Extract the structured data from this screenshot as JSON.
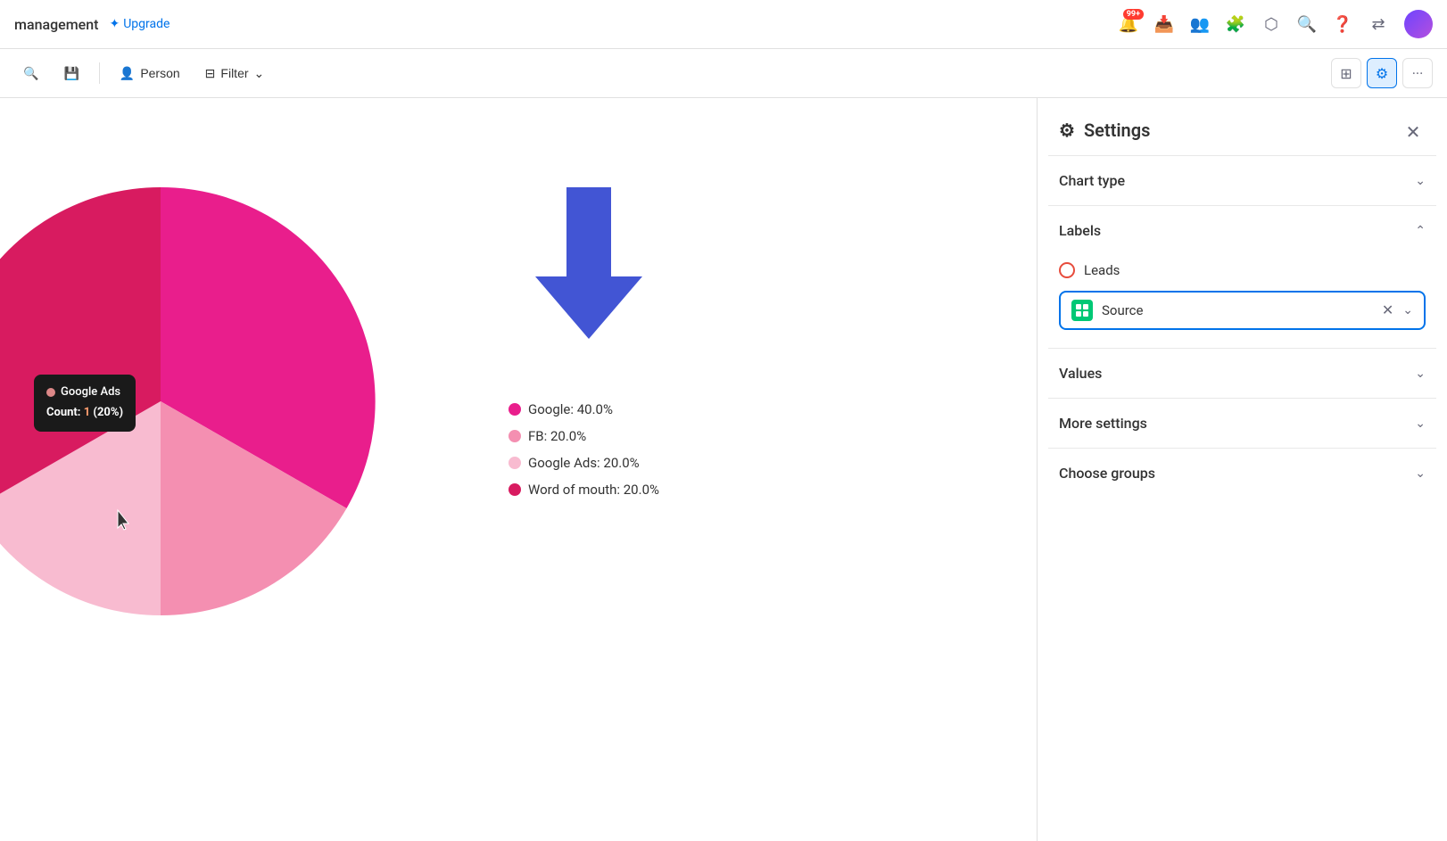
{
  "topbar": {
    "title": "management",
    "upgrade_label": "Upgrade",
    "notification_badge": "99+",
    "close_label": "✕"
  },
  "toolbar": {
    "search_label": "🔍",
    "save_label": "💾",
    "person_label": "Person",
    "filter_label": "Filter",
    "more_label": "···"
  },
  "settings": {
    "title": "Settings",
    "sections": [
      {
        "id": "chart-type",
        "label": "Chart type",
        "expanded": false
      },
      {
        "id": "labels",
        "label": "Labels",
        "expanded": true
      },
      {
        "id": "values",
        "label": "Values",
        "expanded": false
      },
      {
        "id": "more-settings",
        "label": "More settings",
        "expanded": false
      },
      {
        "id": "choose-groups",
        "label": "Choose groups",
        "expanded": false
      }
    ],
    "leads_label": "Leads",
    "source_label": "Source"
  },
  "legend": {
    "items": [
      {
        "label": "Google: 40.0%",
        "color": "#e91e8c"
      },
      {
        "label": "FB: 20.0%",
        "color": "#f48fb1"
      },
      {
        "label": "Google Ads: 20.0%",
        "color": "#f8bbd0"
      },
      {
        "label": "Word of mouth: 20.0%",
        "color": "#d81b60"
      }
    ]
  },
  "tooltip": {
    "title": "Google Ads",
    "count_label": "Count: ",
    "count_value": "1",
    "count_pct": " (20%)"
  }
}
